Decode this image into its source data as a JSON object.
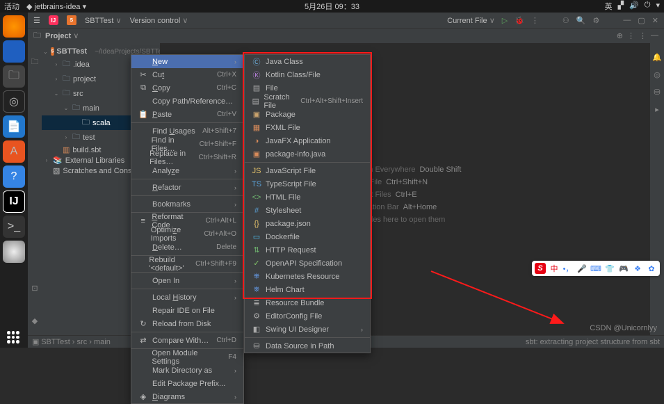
{
  "system": {
    "activities": "活动",
    "appname": "jetbrains-idea",
    "clock": "5月26日 09：33",
    "lang": "英"
  },
  "title": {
    "project": "SBTTest",
    "vcs": "Version control",
    "runcfg": "Current File"
  },
  "projectbar": {
    "label": "Project"
  },
  "tree": {
    "root": "SBTTest",
    "rootpath": "~/IdeaProjects/SBTTest",
    "idea": ".idea",
    "project": "project",
    "src": "src",
    "main": "main",
    "scala": "scala",
    "test": "test",
    "build": "build.sbt",
    "extlib": "External Libraries",
    "scratch": "Scratches and Consoles"
  },
  "hints": {
    "h1": "Search Everywhere",
    "k1": "Double Shift",
    "h2": "Go to File",
    "k2": "Ctrl+Shift+N",
    "h3": "Recent Files",
    "k3": "Ctrl+E",
    "h4": "Navigation Bar",
    "k4": "Alt+Home",
    "h5": "Drop files here to open them"
  },
  "menu1": [
    {
      "icon": "",
      "label": "New",
      "sc": "",
      "arrow": true,
      "hl": true,
      "u": "N"
    },
    {
      "icon": "✂",
      "label": "Cut",
      "sc": "Ctrl+X",
      "u": "t"
    },
    {
      "icon": "⧉",
      "label": "Copy",
      "sc": "Ctrl+C",
      "u": "C"
    },
    {
      "label": "Copy Path/Reference…"
    },
    {
      "icon": "📋",
      "label": "Paste",
      "sc": "Ctrl+V",
      "u": "P"
    },
    {
      "sep": true
    },
    {
      "label": "Find Usages",
      "sc": "Alt+Shift+7",
      "u": "U"
    },
    {
      "label": "Find in Files…",
      "sc": "Ctrl+Shift+F"
    },
    {
      "label": "Replace in Files…",
      "sc": "Ctrl+Shift+R"
    },
    {
      "label": "Analyze",
      "arrow": true,
      "u": "z"
    },
    {
      "sep": true
    },
    {
      "label": "Refactor",
      "arrow": true,
      "u": "R"
    },
    {
      "sep": true
    },
    {
      "label": "Bookmarks",
      "arrow": true
    },
    {
      "sep": true
    },
    {
      "icon": "≡",
      "label": "Reformat Code",
      "sc": "Ctrl+Alt+L",
      "u": "R"
    },
    {
      "label": "Optimize Imports",
      "sc": "Ctrl+Alt+O",
      "u": "z"
    },
    {
      "label": "Delete…",
      "sc": "Delete",
      "u": "D"
    },
    {
      "sep": true
    },
    {
      "label": "Rebuild '<default>'",
      "sc": "Ctrl+Shift+F9"
    },
    {
      "sep": true
    },
    {
      "label": "Open In",
      "arrow": true
    },
    {
      "sep": true
    },
    {
      "label": "Local History",
      "arrow": true,
      "u": "H"
    },
    {
      "label": "Repair IDE on File"
    },
    {
      "icon": "↻",
      "label": "Reload from Disk"
    },
    {
      "sep": true
    },
    {
      "icon": "⇄",
      "label": "Compare With…",
      "sc": "Ctrl+D"
    },
    {
      "sep": true
    },
    {
      "label": "Open Module Settings",
      "sc": "F4"
    },
    {
      "label": "Mark Directory as",
      "arrow": true
    },
    {
      "label": "Edit Package Prefix..."
    },
    {
      "icon": "◈",
      "label": "Diagrams",
      "arrow": true,
      "u": "D"
    }
  ],
  "menu2": [
    {
      "icon": "Ⓒ",
      "cls": "cls-c",
      "label": "Java Class"
    },
    {
      "icon": "Ⓚ",
      "cls": "cls-k",
      "label": "Kotlin Class/File"
    },
    {
      "icon": "▤",
      "cls": "cls-f",
      "label": "File"
    },
    {
      "icon": "▤",
      "cls": "cls-f",
      "label": "Scratch File",
      "sc": "Ctrl+Alt+Shift+Insert"
    },
    {
      "icon": "▣",
      "cls": "cls-p",
      "label": "Package"
    },
    {
      "icon": "▦",
      "cls": "cls-r",
      "label": "FXML File"
    },
    {
      "icon": "◑",
      "cls": "cls-r",
      "label": "JavaFX Application"
    },
    {
      "icon": "▣",
      "cls": "cls-r",
      "label": "package-info.java"
    },
    {
      "sep": true
    },
    {
      "icon": "JS",
      "cls": "cls-j",
      "label": "JavaScript File"
    },
    {
      "icon": "TS",
      "cls": "cls-s",
      "label": "TypeScript File"
    },
    {
      "icon": "<>",
      "cls": "cls-h",
      "label": "HTML File"
    },
    {
      "icon": "#",
      "cls": "cls-s",
      "label": "Stylesheet"
    },
    {
      "icon": "{}",
      "cls": "cls-j",
      "label": "package.json"
    },
    {
      "icon": "▭",
      "cls": "cls-d",
      "label": "Dockerfile"
    },
    {
      "icon": "⇅",
      "cls": "cls-h",
      "label": "HTTP Request"
    },
    {
      "icon": "✓",
      "cls": "cls-o",
      "label": "OpenAPI Specification"
    },
    {
      "icon": "⎈",
      "cls": "cls-kk",
      "label": "Kubernetes Resource"
    },
    {
      "icon": "⎈",
      "cls": "cls-kk",
      "label": "Helm Chart"
    },
    {
      "icon": "≣",
      "cls": "cls-f",
      "label": "Resource Bundle"
    },
    {
      "icon": "⚙",
      "cls": "cls-f",
      "label": "EditorConfig File"
    },
    {
      "icon": "◧",
      "cls": "cls-f",
      "label": "Swing UI Designer",
      "arrow": true
    },
    {
      "sep": true
    },
    {
      "icon": "⛁",
      "cls": "cls-f",
      "label": "Data Source in Path"
    }
  ],
  "status": {
    "crumbs": "SBTTest › src › main",
    "msg": "sbt: extracting project structure from sbt"
  },
  "watermark": "CSDN @Unicornlyy"
}
